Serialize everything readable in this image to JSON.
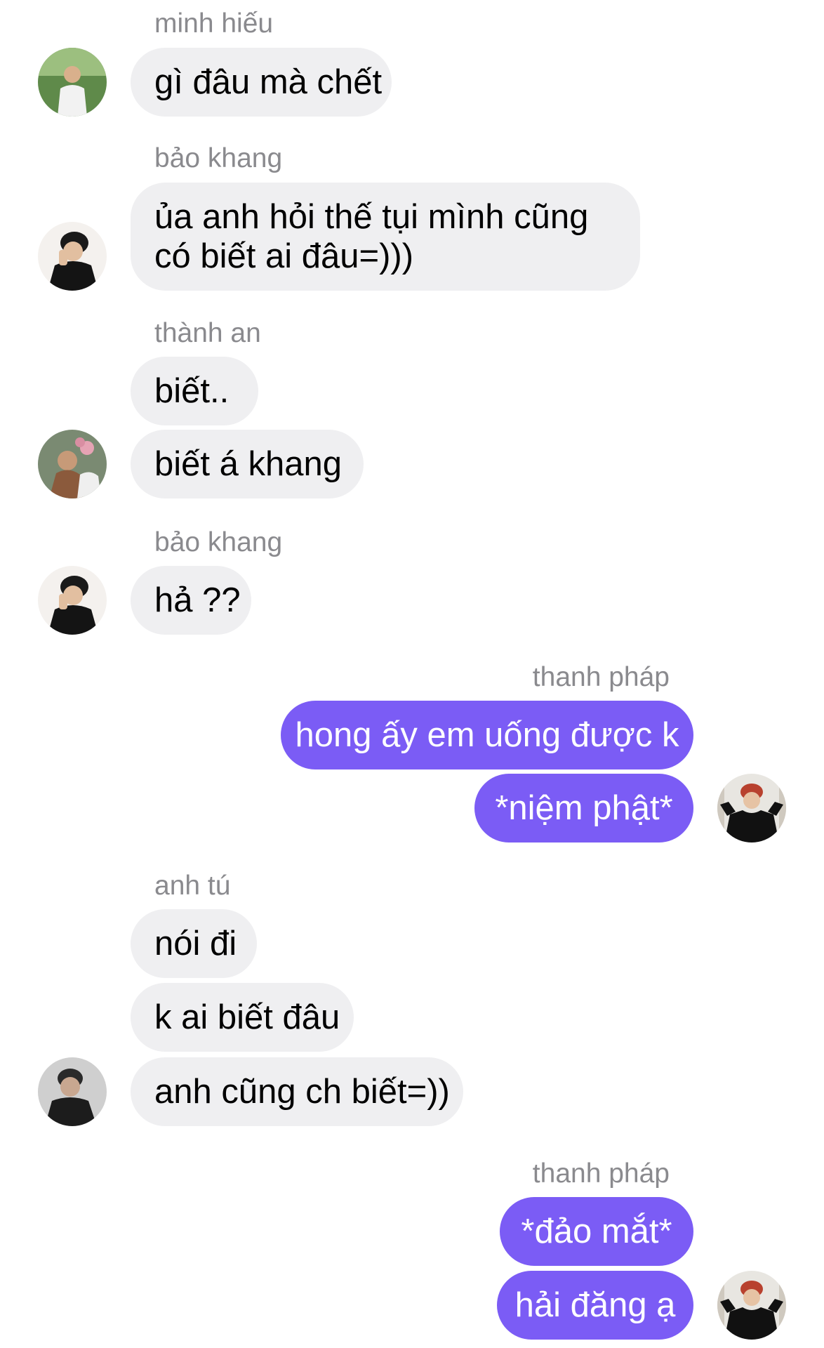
{
  "theme": {
    "incoming_bubble": "#efeff1",
    "outgoing_bubble": "#7b5cf5",
    "sender_name_color": "#8a8a8e"
  },
  "groups": [
    {
      "sender": "minh hiếu",
      "direction": "incoming",
      "messages": [
        "gì đâu mà chết"
      ]
    },
    {
      "sender": "bảo khang",
      "direction": "incoming",
      "messages": [
        "ủa anh hỏi thế tụi mình cũng có biết ai đâu=)))"
      ]
    },
    {
      "sender": "thành an",
      "direction": "incoming",
      "messages": [
        "biết..",
        "biết á khang"
      ]
    },
    {
      "sender": "bảo khang",
      "direction": "incoming",
      "messages": [
        "hả ??"
      ]
    },
    {
      "sender": "thanh pháp",
      "direction": "outgoing",
      "messages": [
        "hong ấy em uống được k",
        "*niệm phật*"
      ]
    },
    {
      "sender": "anh tú",
      "direction": "incoming",
      "messages": [
        "nói đi",
        "k ai biết đâu",
        "anh cũng ch biết=))"
      ]
    },
    {
      "sender": "thanh pháp",
      "direction": "outgoing",
      "messages": [
        "*đảo mắt*",
        "hải đăng ạ"
      ]
    }
  ]
}
